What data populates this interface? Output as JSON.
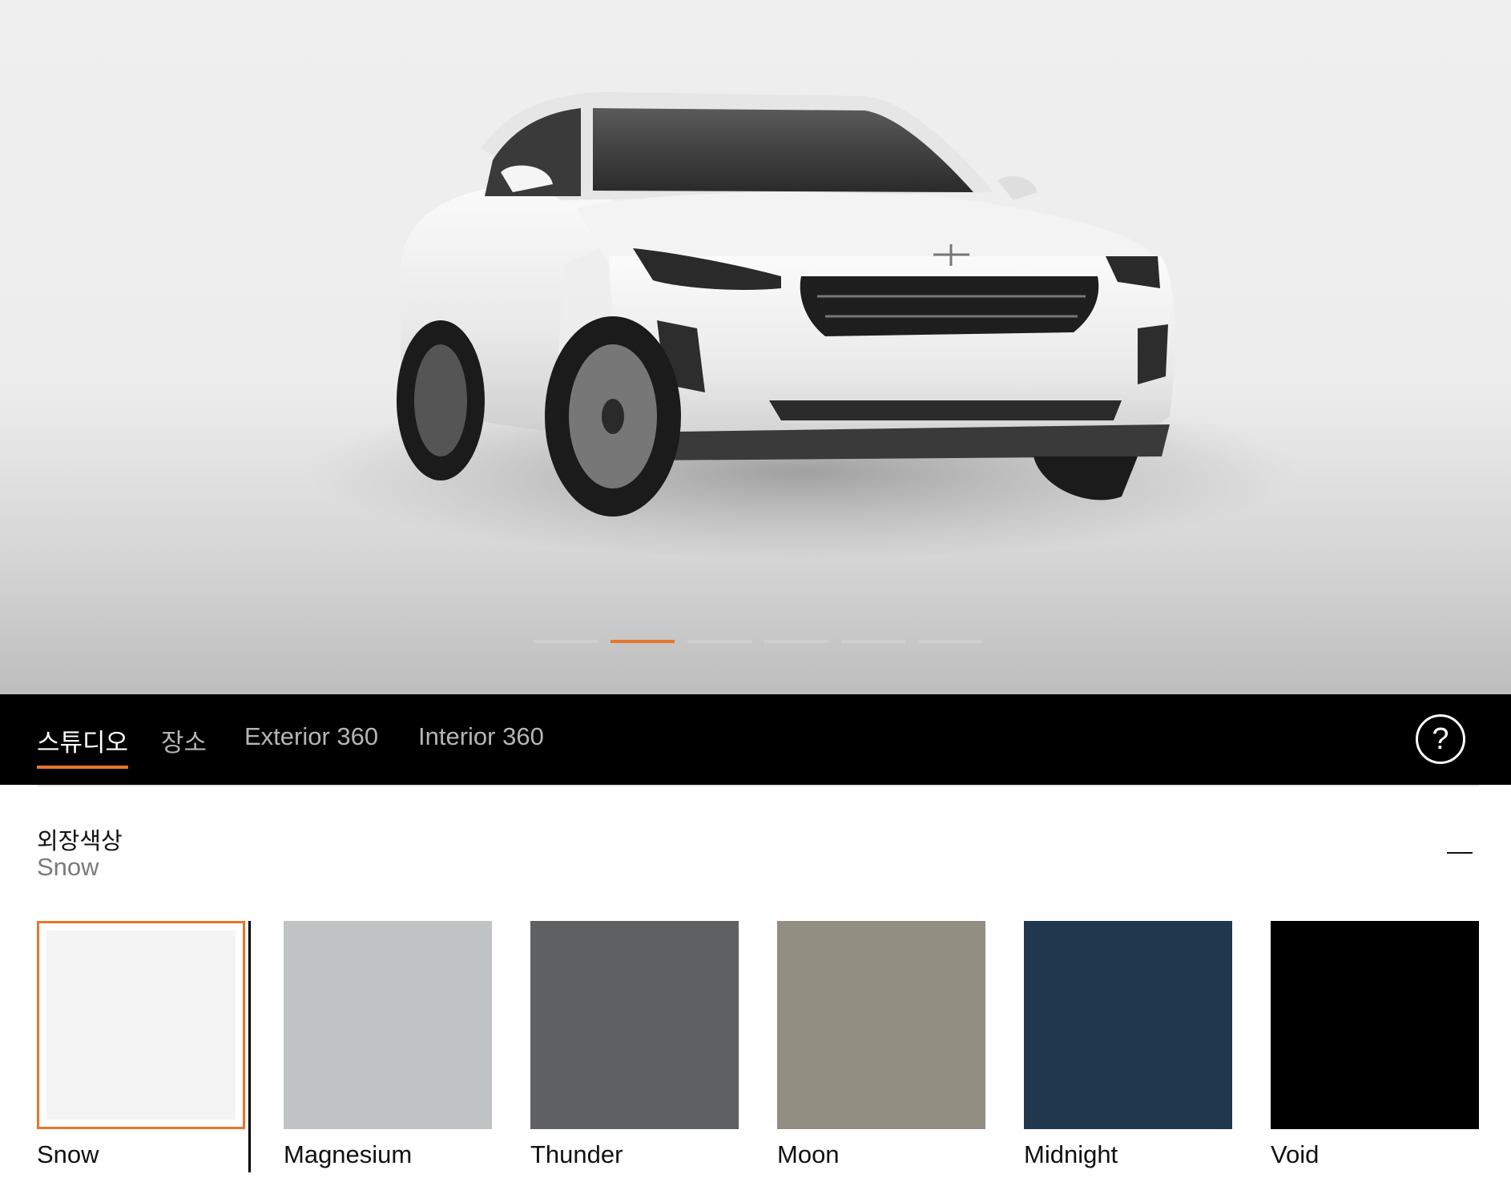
{
  "carousel": {
    "slide_count": 6,
    "active_index": 1,
    "accent_color": "#e8762b"
  },
  "view_tabs": [
    {
      "label": "스튜디오",
      "active": true
    },
    {
      "label": "장소",
      "active": false
    },
    {
      "label": "Exterior 360",
      "active": false
    },
    {
      "label": "Interior 360",
      "active": false
    }
  ],
  "help": {
    "label": "?",
    "icon": "help-circle-icon"
  },
  "exterior_color": {
    "title": "외장색상",
    "selected_value": "Snow",
    "collapse_icon": "minus-icon",
    "swatches": [
      {
        "name": "Snow",
        "color": "#f4f4f4",
        "selected": true
      },
      {
        "name": "Magnesium",
        "color": "#bfc3c4",
        "selected": false
      },
      {
        "name": "Thunder",
        "color": "#5f6163",
        "selected": false
      },
      {
        "name": "Moon",
        "color": "#928f82",
        "selected": false
      },
      {
        "name": "Midnight",
        "color": "#1f384e",
        "selected": false
      },
      {
        "name": "Void",
        "color": "#000000",
        "selected": false
      }
    ]
  }
}
